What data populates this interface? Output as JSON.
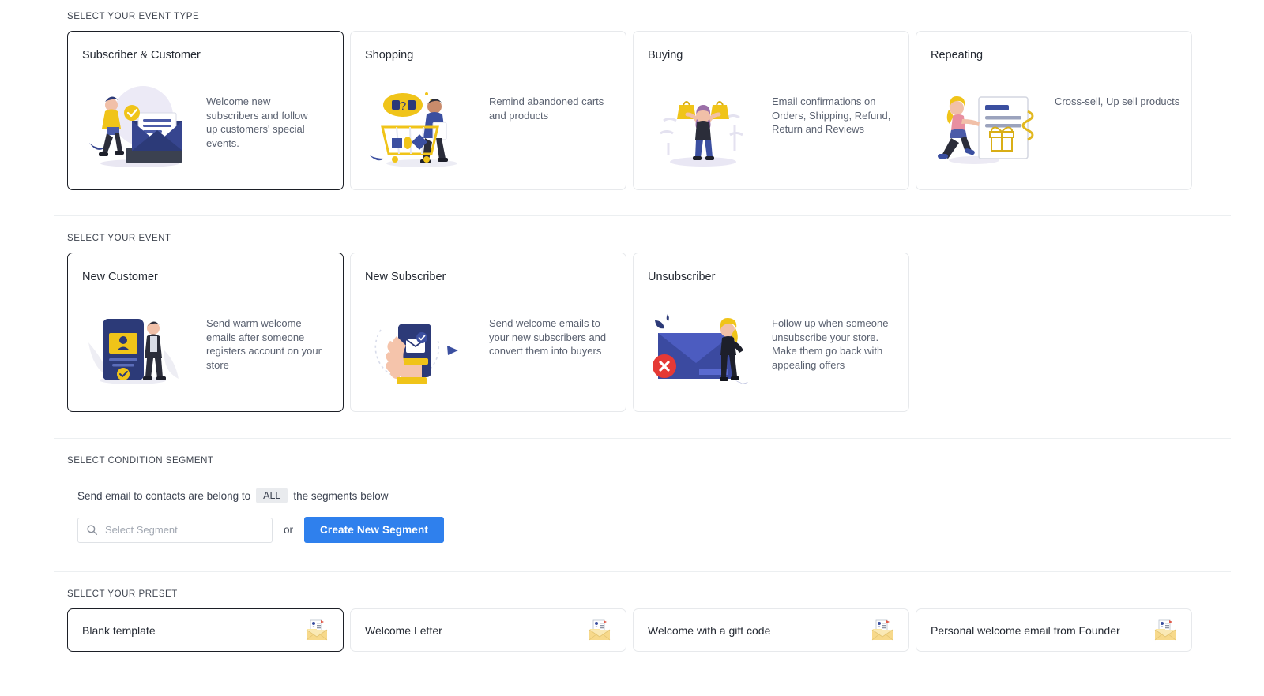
{
  "sections": {
    "event_type": {
      "label": "SELECT YOUR EVENT TYPE"
    },
    "event": {
      "label": "SELECT YOUR EVENT"
    },
    "condition": {
      "label": "SELECT CONDITION SEGMENT"
    },
    "preset": {
      "label": "SELECT YOUR PRESET"
    }
  },
  "event_types": [
    {
      "title": "Subscriber & Customer",
      "description": "Welcome new subscribers and follow up customers' special events.",
      "selected": true,
      "icon": "person-with-envelope-illustration"
    },
    {
      "title": "Shopping",
      "description": "Remind abandoned carts and products",
      "selected": false,
      "icon": "person-with-cart-illustration"
    },
    {
      "title": "Buying",
      "description": "Email confirmations on Orders, Shipping, Refund, Return and Reviews",
      "selected": false,
      "icon": "person-with-shopping-bags-illustration"
    },
    {
      "title": "Repeating",
      "description": "Cross-sell, Up sell products",
      "selected": false,
      "icon": "person-with-gift-document-illustration"
    }
  ],
  "events": [
    {
      "title": "New Customer",
      "description": "Send warm welcome emails after someone registers account on your store",
      "selected": true,
      "icon": "phone-profile-illustration"
    },
    {
      "title": "New Subscriber",
      "description": "Send welcome emails to your new subscribers and convert them into buyers",
      "selected": false,
      "icon": "hand-holding-phone-illustration"
    },
    {
      "title": "Unsubscriber",
      "description": "Follow up when someone unsubscribe your store. Make them go back with appealing offers",
      "selected": false,
      "icon": "envelope-with-error-illustration"
    }
  ],
  "condition": {
    "sentence_before": "Send email to contacts are belong to",
    "operator": "ALL",
    "sentence_after": "the segments below",
    "search_placeholder": "Select Segment",
    "search_value": "",
    "or_label": "or",
    "create_button": "Create New Segment"
  },
  "presets": [
    {
      "label": "Blank template",
      "selected": true,
      "icon": "email-template-icon"
    },
    {
      "label": "Welcome Letter",
      "selected": false,
      "icon": "email-template-icon"
    },
    {
      "label": "Welcome with a gift code",
      "selected": false,
      "icon": "email-template-icon"
    },
    {
      "label": "Personal welcome email from Founder",
      "selected": false,
      "icon": "email-template-icon"
    }
  ],
  "colors": {
    "primary_button": "#2f80ed",
    "selected_border": "#1c1f26",
    "card_border": "#e7e9ec",
    "illustration_navy": "#2c3a78",
    "illustration_yellow": "#f0c419",
    "illustration_red": "#e53935"
  }
}
